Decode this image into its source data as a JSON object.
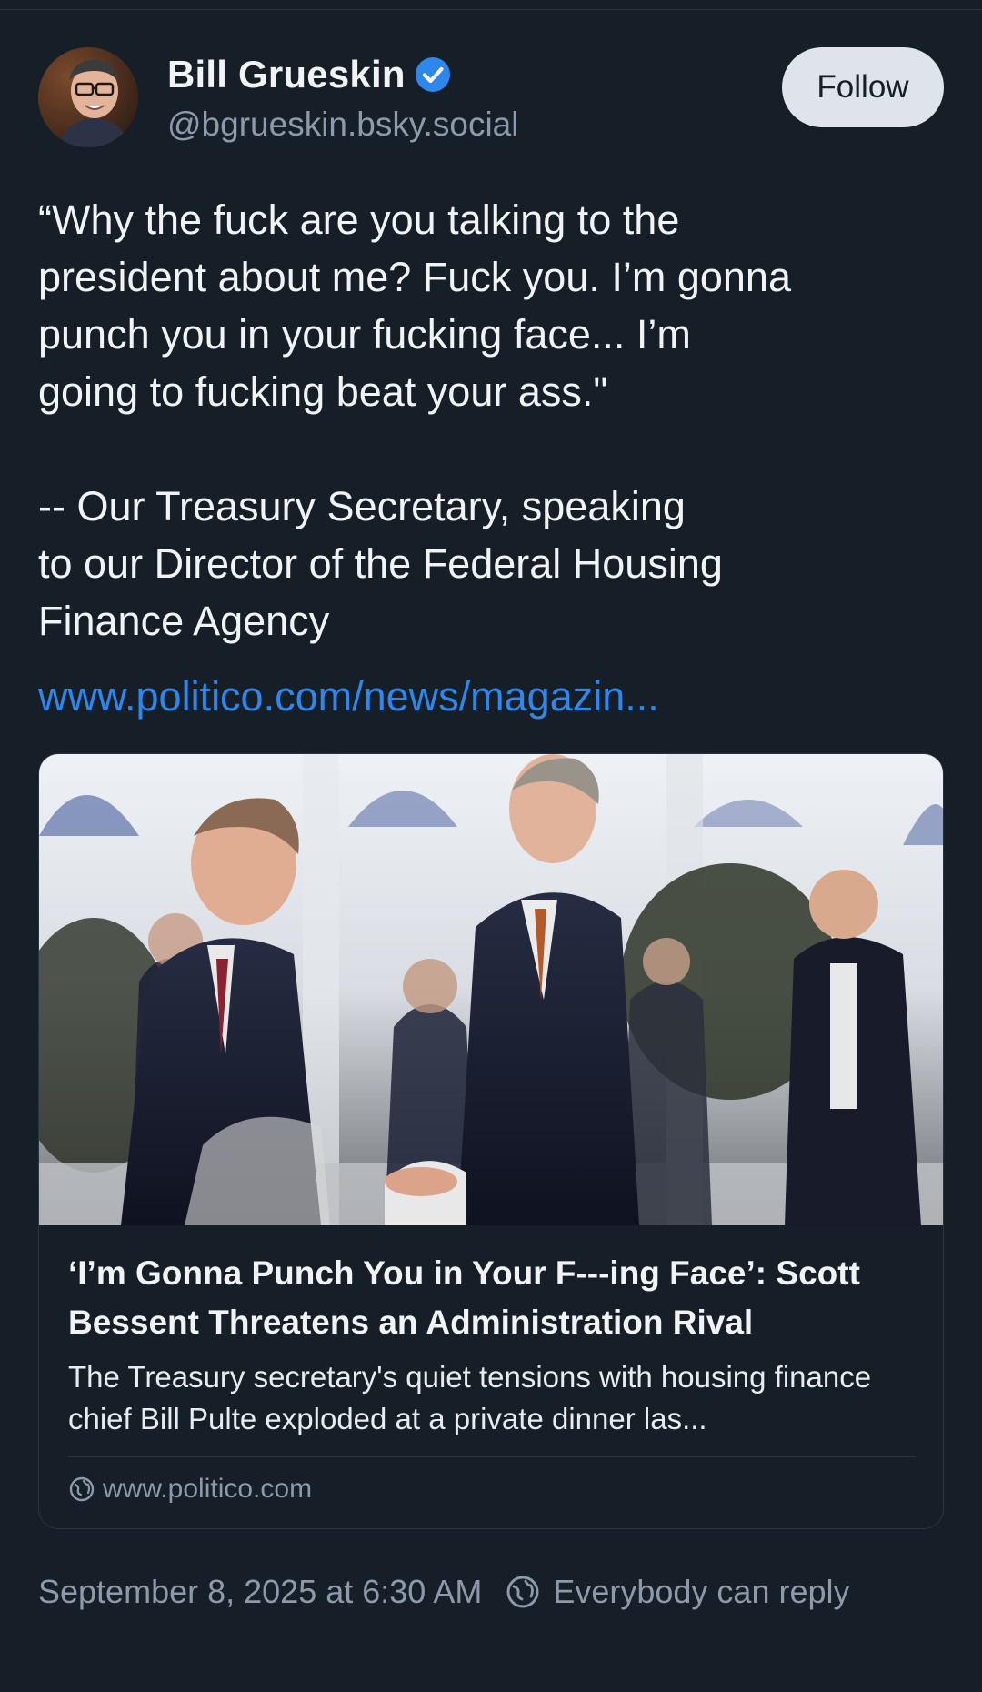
{
  "author": {
    "display_name": "Bill Grueskin",
    "handle": "@bgrueskin.bsky.social",
    "verified": true
  },
  "follow_label": "Follow",
  "post": {
    "text": "“Why the fuck are you talking to the\npresident about me? Fuck you. I’m gonna\npunch you in your fucking face... I’m\ngoing to fucking beat your ass.\"\n\n-- Our Treasury Secretary, speaking\nto our Director of the Federal Housing\nFinance Agency",
    "link": "www.politico.com/news/magazin..."
  },
  "link_card": {
    "title": "‘I’m Gonna Punch You in Your F---ing Face’: Scott Bessent Threatens an Administration Rival",
    "description": "The Treasury secretary's quiet tensions with housing finance chief Bill Pulte exploded at a private dinner las...",
    "domain": "www.politico.com"
  },
  "footer": {
    "timestamp": "September 8, 2025 at 6:30 AM",
    "reply_setting": "Everybody can reply"
  },
  "colors": {
    "background": "#161e27",
    "link": "#2d87ec",
    "muted": "#8c9aab",
    "verified": "#2d87ec"
  }
}
